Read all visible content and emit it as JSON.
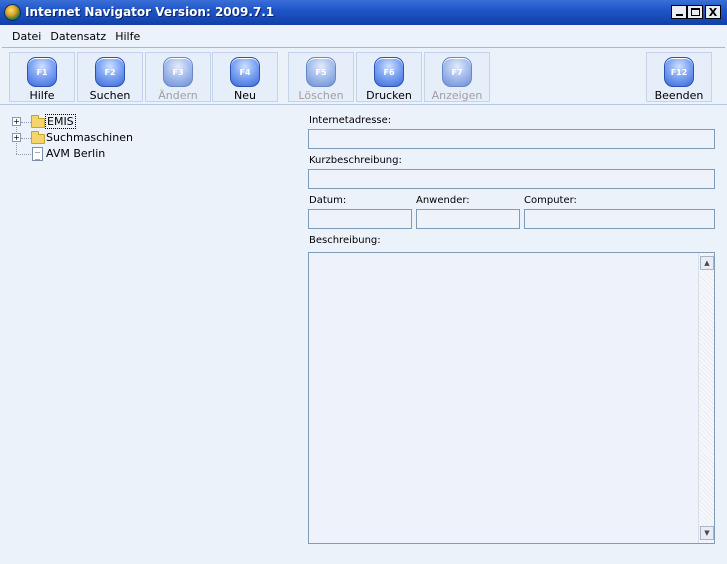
{
  "window": {
    "title": "Internet Navigator Version: 2009.7.1",
    "controls": {
      "minimize": "_",
      "maximize": "□",
      "close": "X"
    }
  },
  "menu": {
    "items": [
      "Datei",
      "Datensatz",
      "Hilfe"
    ]
  },
  "toolbar": {
    "buttons": [
      {
        "key": "F1",
        "label": "Hilfe",
        "enabled": true
      },
      {
        "key": "F2",
        "label": "Suchen",
        "enabled": true
      },
      {
        "key": "F3",
        "label": "Ändern",
        "enabled": false
      },
      {
        "key": "F4",
        "label": "Neu",
        "enabled": true
      },
      {
        "key": "F5",
        "label": "Löschen",
        "enabled": false
      },
      {
        "key": "F6",
        "label": "Drucken",
        "enabled": true
      },
      {
        "key": "F7",
        "label": "Anzeigen",
        "enabled": false
      },
      {
        "key": "F12",
        "label": "Beenden",
        "enabled": true
      }
    ]
  },
  "tree": {
    "items": [
      {
        "label": "EMIS",
        "type": "folder",
        "expandable": true,
        "selected": true,
        "expander": "+"
      },
      {
        "label": "Suchmaschinen",
        "type": "folder",
        "expandable": true,
        "selected": false,
        "expander": "+"
      },
      {
        "label": "AVM Berlin",
        "type": "document",
        "expandable": false,
        "selected": false
      }
    ]
  },
  "form": {
    "internetadresse": {
      "label": "Internetadresse:",
      "value": ""
    },
    "kurzbeschreibung": {
      "label": "Kurzbeschreibung:",
      "value": ""
    },
    "datum": {
      "label": "Datum:",
      "value": ""
    },
    "anwender": {
      "label": "Anwender:",
      "value": ""
    },
    "computer": {
      "label": "Computer:",
      "value": ""
    },
    "beschreibung": {
      "label": "Beschreibung:",
      "value": ""
    }
  },
  "scrollbar": {
    "up": "▲",
    "down": "▼"
  }
}
